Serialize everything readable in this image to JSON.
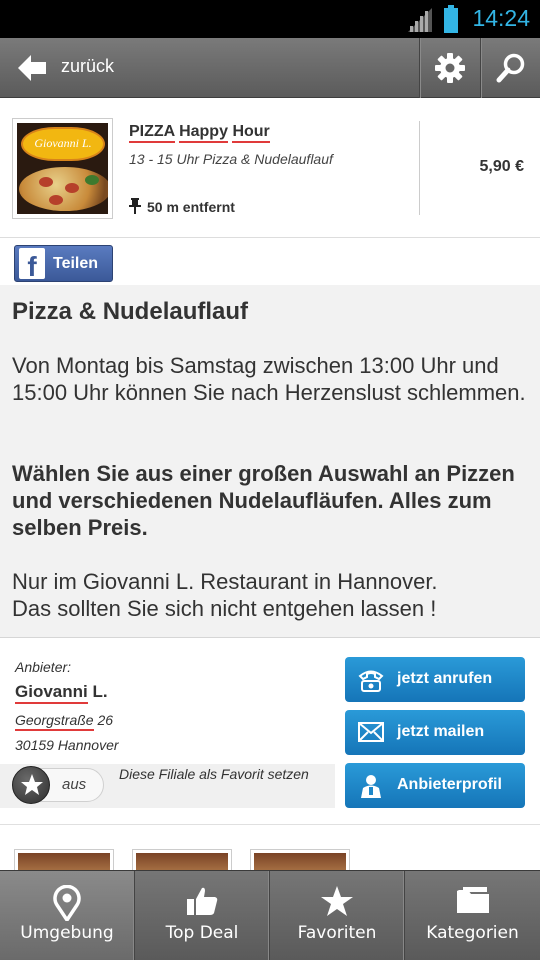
{
  "status_bar": {
    "time": "14:24"
  },
  "header": {
    "back_label": "zurück"
  },
  "deal": {
    "title_word1": "PIZZA",
    "title_word2": "Happy",
    "title_word3": "Hour",
    "subtitle": "13 - 15 Uhr Pizza & Nudelauflauf",
    "distance": "50 m entfernt",
    "price": "5,90 €",
    "thumbnail_text": "Giovanni L."
  },
  "share": {
    "label": "Teilen"
  },
  "description": {
    "title": "Pizza & Nudelauflauf",
    "paragraph1": "Von Montag bis Samstag zwischen 13:00 Uhr und 15:00 Uhr können Sie nach Herzenslust schlemmen.",
    "paragraph2": "Wählen Sie aus einer großen Auswahl an Pizzen und verschiedenen Nudelaufläufen. Alles zum selben Preis.",
    "paragraph3_line1": "Nur im Giovanni L. Restaurant in Hannover.",
    "paragraph3_line2": "Das sollten Sie sich nicht entgehen lassen !"
  },
  "provider": {
    "label": "Anbieter:",
    "name_part1": "Giovanni",
    "name_part2": " L.",
    "street_part1": "Georgstraße",
    "street_part2": " 26",
    "city": "30159 Hannover",
    "favorite_toggle_label": "aus",
    "favorite_text": "Diese Filiale als Favorit setzen",
    "call_button": "jetzt anrufen",
    "mail_button": "jetzt mailen",
    "profile_button": "Anbieterprofil"
  },
  "bottom_nav": {
    "tabs": [
      {
        "label": "Umgebung",
        "icon": "location-pin-icon"
      },
      {
        "label": "Top Deal",
        "icon": "thumbs-up-icon"
      },
      {
        "label": "Favoriten",
        "icon": "star-icon"
      },
      {
        "label": "Kategorien",
        "icon": "folder-icon"
      }
    ]
  },
  "colors": {
    "accent_blue": "#1e88c9",
    "status_clock": "#33b5e5",
    "facebook_blue": "#3b5998",
    "spellcheck_red": "#e03a3a"
  }
}
